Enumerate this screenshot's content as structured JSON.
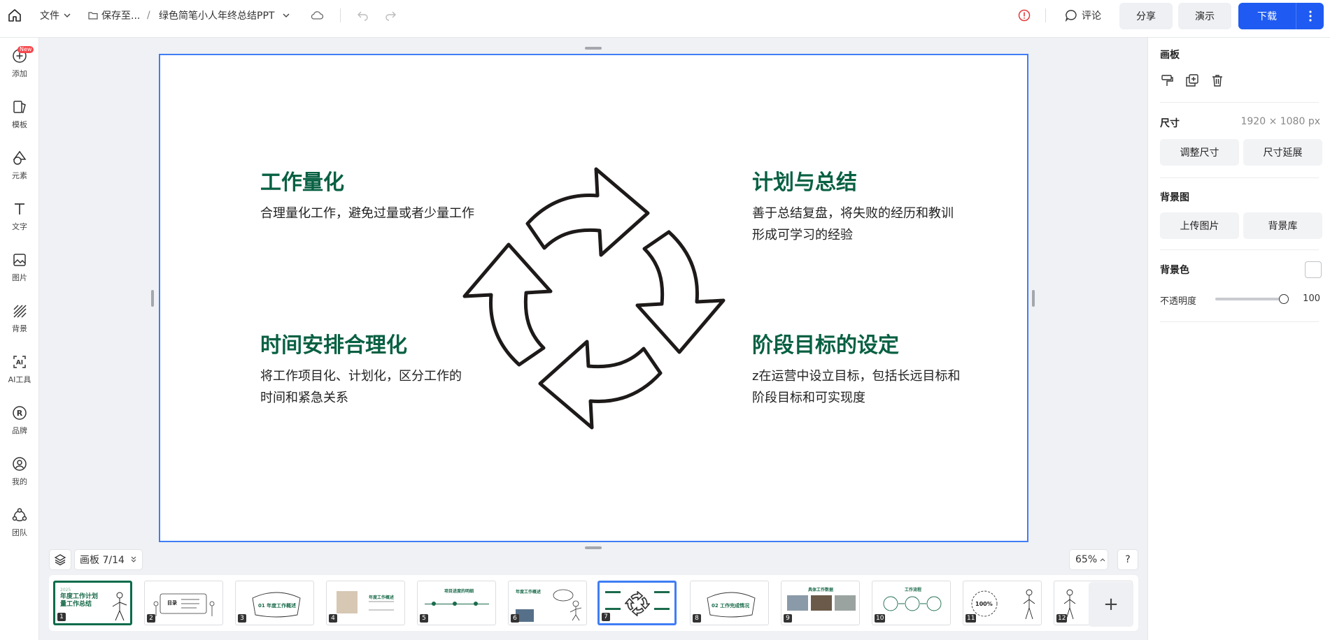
{
  "topbar": {
    "file_menu": "文件",
    "save_to": "保存至...",
    "separator": "/",
    "doc_title": "绿色简笔小人年终总结PPT",
    "comment": "评论",
    "share": "分享",
    "present": "演示",
    "download": "下载"
  },
  "sidebar": {
    "new_badge": "New",
    "items": [
      {
        "label": "添加",
        "icon": "plus-circle-icon"
      },
      {
        "label": "模板",
        "icon": "template-icon"
      },
      {
        "label": "元素",
        "icon": "shapes-icon"
      },
      {
        "label": "文字",
        "icon": "text-icon"
      },
      {
        "label": "图片",
        "icon": "image-icon"
      },
      {
        "label": "背景",
        "icon": "background-icon"
      },
      {
        "label": "AI工具",
        "icon": "ai-icon"
      },
      {
        "label": "品牌",
        "icon": "brand-icon"
      },
      {
        "label": "我的",
        "icon": "user-icon"
      },
      {
        "label": "团队",
        "icon": "team-icon"
      }
    ]
  },
  "slide": {
    "sections": [
      {
        "title": "工作量化",
        "desc": "合理量化工作，避免过量或者少量工作"
      },
      {
        "title": "计划与总结",
        "desc": "善于总结复盘，将失败的经历和教训形成可学习的经验"
      },
      {
        "title": "时间安排合理化",
        "desc": "将工作项目化、计划化，区分工作的时间和紧急关系"
      },
      {
        "title": "阶段目标的设定",
        "desc": "z在运营中设立目标，包括长远目标和阶段目标和可实现度"
      }
    ]
  },
  "right_panel": {
    "title": "画板",
    "size_label": "尺寸",
    "size_value": "1920 × 1080 px",
    "resize_btn": "调整尺寸",
    "extend_btn": "尺寸延展",
    "bg_image_label": "背景图",
    "upload_btn": "上传图片",
    "bg_library_btn": "背景库",
    "bg_color_label": "背景色",
    "opacity_label": "不透明度",
    "opacity_value": "100",
    "opacity_fraction": 1.0
  },
  "bottom": {
    "board_indicator": "画板 7/14",
    "zoom": "65%",
    "help": "?",
    "add": "+"
  },
  "thumbnails": [
    {
      "num": "1",
      "text": "年度工作计划 量工作总结",
      "sub": "2025"
    },
    {
      "num": "2",
      "text": "目录"
    },
    {
      "num": "3",
      "text": "01 年度工作概述"
    },
    {
      "num": "4",
      "text": "年度工作概述"
    },
    {
      "num": "5",
      "text": "项目进度的明细"
    },
    {
      "num": "6",
      "text": "年度工作概述"
    },
    {
      "num": "7",
      "text": ""
    },
    {
      "num": "8",
      "text": "02 工作完成情况"
    },
    {
      "num": "9",
      "text": "具体工作数据"
    },
    {
      "num": "10",
      "text": "工作流程"
    },
    {
      "num": "11",
      "text": "100%"
    },
    {
      "num": "12",
      "text": ""
    }
  ]
}
